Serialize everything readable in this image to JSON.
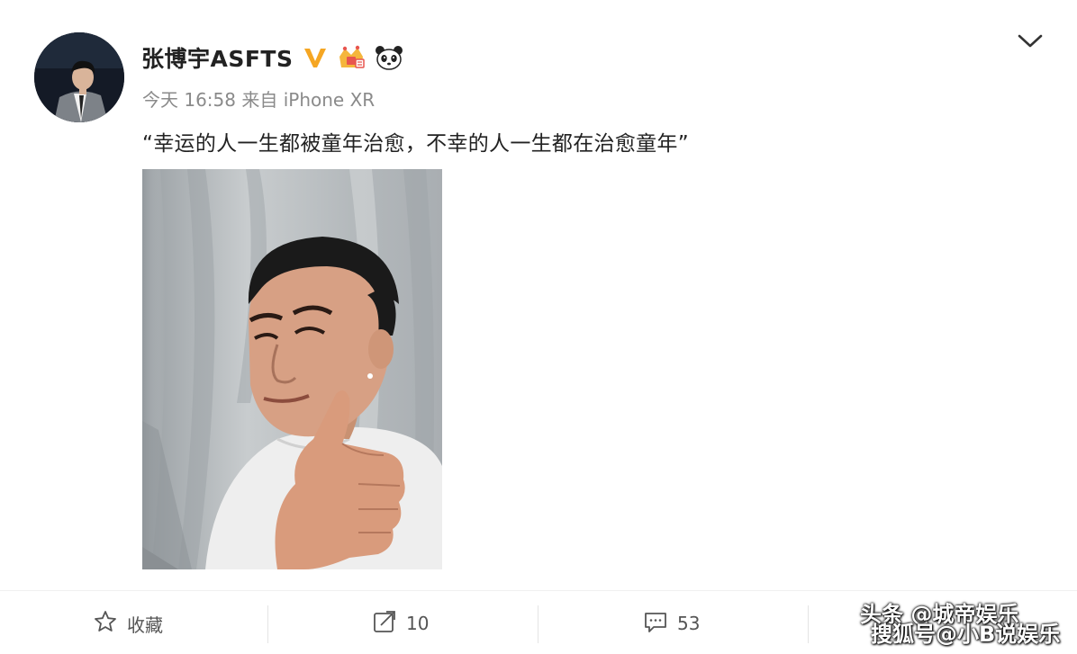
{
  "post": {
    "username": "张博宇ASFTS",
    "meta": "今天 16:58 来自 iPhone XR",
    "text": "“幸运的人一生都被童年治愈，不幸的人一生都在治愈童年”"
  },
  "badges": [
    "verified-v-icon",
    "crown-badge-icon",
    "panda-icon"
  ],
  "actions": {
    "favorite_label": "收藏",
    "repost_count": "10",
    "comment_count": "53"
  },
  "watermark": {
    "line1": "头条 @城帝娱乐",
    "line2": "搜狐号@小B说娱乐"
  },
  "colors": {
    "verified": "#f5a623",
    "meta_text": "#8a8a8a",
    "action_text": "#555555"
  }
}
